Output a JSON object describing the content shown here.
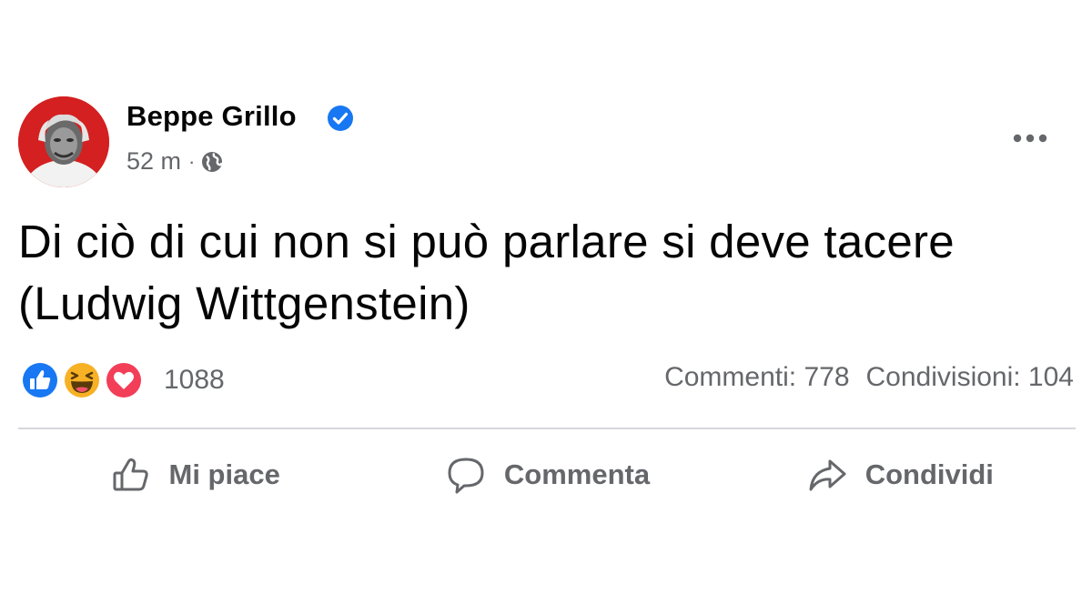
{
  "post": {
    "author": "Beppe Grillo",
    "timestamp": "52 m",
    "separator": "·",
    "audience_icon": "globe-icon",
    "verified_icon": "verified-badge-icon",
    "more_icon": "more-options-icon",
    "text": "Di ciò di cui non si può parlare si deve tacere (Ludwig Wittgenstein)"
  },
  "reactions": {
    "icons": [
      "like-reaction-icon",
      "haha-reaction-icon",
      "love-reaction-icon"
    ],
    "count": "1088"
  },
  "stats": {
    "comments": "Commenti: 778",
    "shares": "Condivisioni: 104"
  },
  "actions": {
    "like": "Mi piace",
    "comment": "Commenta",
    "share": "Condividi"
  },
  "colors": {
    "verified": "#1877f2",
    "like": "#1877f2",
    "haha": "#f7b125",
    "love": "#f33e58",
    "secondary_text": "#65676b"
  }
}
